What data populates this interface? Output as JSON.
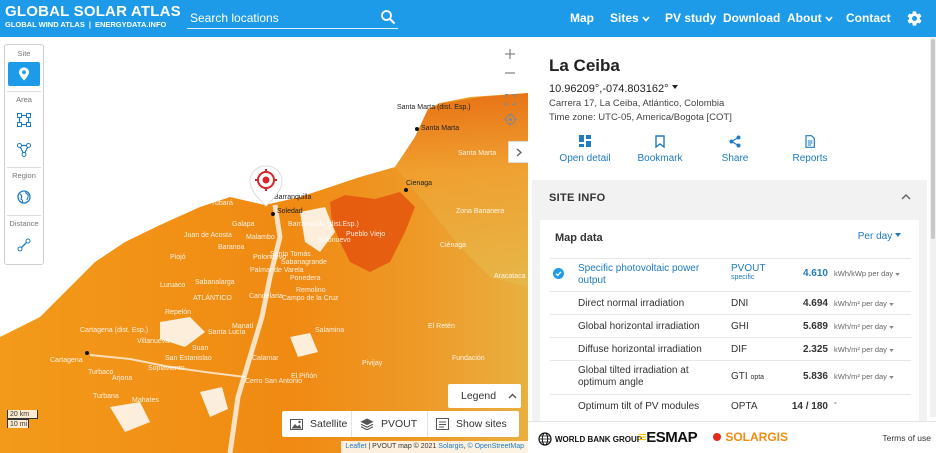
{
  "header": {
    "logo_line1": "GLOBAL SOLAR ATLAS",
    "logo_line2a": "GLOBAL WIND ATLAS",
    "logo_line2b": "ENERGYDATA.INFO",
    "search_placeholder": "Search locations",
    "nav": [
      "Map",
      "Sites",
      "PV study",
      "Download",
      "About",
      "Contact"
    ],
    "settings_icon": "gear-icon"
  },
  "toolbar": {
    "site_label": "Site",
    "area_label": "Area",
    "region_label": "Region",
    "distance_label": "Distance"
  },
  "map": {
    "towns": [
      "Santa Marta\n(dist. Esp.)",
      "Santa Marta",
      "Santa Marta",
      "Cienaga",
      "Puerto Colombia",
      "Barranquilla",
      "Soledad",
      "Malambo",
      "Galapa",
      "Barranquilla (dist.Esp.)",
      "Tubará",
      "Juan de Acosta",
      "Baranoa",
      "Piojó",
      "Polonuevo",
      "Sabanagrande",
      "Santo Tomás",
      "Palmar de Varela",
      "Ponedera",
      "Sabanalarga",
      "ATLÁNTICO",
      "Luruaco",
      "Repelón",
      "Candelaria",
      "Campo de la Cruz",
      "Manatí",
      "Santa Lucía",
      "Suan",
      "Salamina",
      "Pivijay",
      "Cartagena (dist. Esp.)",
      "Cartagena",
      "Turbaco",
      "Arjona",
      "Turbana",
      "Villanueva",
      "San Estanislao",
      "Soplaviento",
      "Calamar",
      "El Piñón",
      "Cerro San Antonio",
      "Zona Bananera",
      "Aracataca",
      "Pueblo Viejo",
      "Sitionuevo",
      "Remolino",
      "Mahates",
      "Fundación",
      "El Retén",
      "Ciénaga"
    ],
    "legend_label": "Legend",
    "layers": [
      "Satellite",
      "PVOUT",
      "Show sites"
    ],
    "scale_km": "20 km",
    "scale_mi": "10 mi",
    "attribution_leaflet": "Leaflet",
    "attribution_text": " | PVOUT map © 2021 ",
    "attribution_solargis": "Solargis",
    "attribution_osm": "© OpenStreetMap"
  },
  "site": {
    "title": "La Ceiba",
    "coords": "10.96209°,-074.803162°",
    "address": "Carrera 17, La Ceiba, Atlántico, Colombia",
    "timezone": "Time zone: UTC-05, America/Bogota [COT]",
    "actions": [
      "Open detail",
      "Bookmark",
      "Share",
      "Reports"
    ]
  },
  "site_info": {
    "heading": "SITE INFO",
    "map_data_title": "Map data",
    "period": "Per day",
    "rows": [
      {
        "name": "Specific photovoltaic power output",
        "abbr": "PVOUT",
        "abbr_sub": "specific",
        "value": "4.610",
        "unit": "kWh/kWp per day",
        "selected": true
      },
      {
        "name": "Direct normal irradiation",
        "abbr": "DNI",
        "value": "4.694",
        "unit": "kWh/m² per day"
      },
      {
        "name": "Global horizontal irradiation",
        "abbr": "GHI",
        "value": "5.689",
        "unit": "kWh/m² per day"
      },
      {
        "name": "Diffuse horizontal irradiation",
        "abbr": "DIF",
        "value": "2.325",
        "unit": "kWh/m² per day"
      },
      {
        "name": "Global tilted irradiation at optimum angle",
        "abbr": "GTI",
        "abbr_sub": "opta",
        "value": "5.836",
        "unit": "kWh/m² per day"
      },
      {
        "name": "Optimum tilt of PV modules",
        "abbr": "OPTA",
        "value": "14 / 180",
        "unit": "°"
      }
    ]
  },
  "footer": {
    "world_bank": "WORLD BANK GROUP",
    "esmap": "ESMAP",
    "solargis": "SOLARGIS",
    "terms": "Terms of use"
  },
  "colors": {
    "brand_blue": "#1e9be8",
    "link_blue": "#1e7bc4",
    "map_orange": "#f08c10"
  }
}
